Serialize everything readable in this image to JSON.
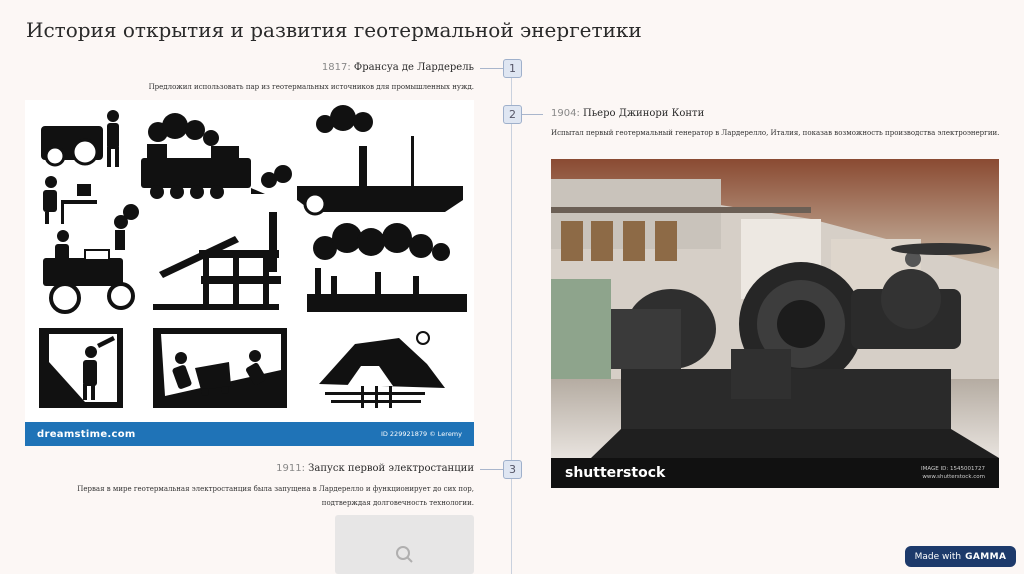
{
  "title": "История открытия и развития геотермальной энергетики",
  "events": [
    {
      "number": "1",
      "year": "1817:",
      "name": "Франсуа де Лардерель",
      "description": "Предложил использовать пар из геотермальных источников для промышленных нужд."
    },
    {
      "number": "2",
      "year": "1904:",
      "name": "Пьеро Джинори Конти",
      "description": "Испытал первый геотермальный генератор в Лардерелло, Италия, показав возможность производства электроэнергии."
    },
    {
      "number": "3",
      "year": "1911:",
      "name": "Запуск первой электростанции",
      "description": "Первая в мире геотермальная электростанция была запущена в Лардерелло и функционирует до сих пор, подтверждая долговечность технологии."
    }
  ],
  "pictogram_image": {
    "brand": "dreamstime.com",
    "image_id": "ID 229921879 © Leremy"
  },
  "photo_image": {
    "brand": "shutterstock",
    "image_id": "IMAGE ID: 1545001727",
    "site": "www.shutterstock.com"
  },
  "badge": {
    "prefix": "Made with",
    "brand": "GAMMA"
  },
  "colors": {
    "background": "#fcf7f5",
    "timeline": "#c9d1de",
    "marker_fill": "#dfe6f2",
    "dreamstime_bar": "#1f73b7",
    "badge": "#1d3a6b"
  }
}
